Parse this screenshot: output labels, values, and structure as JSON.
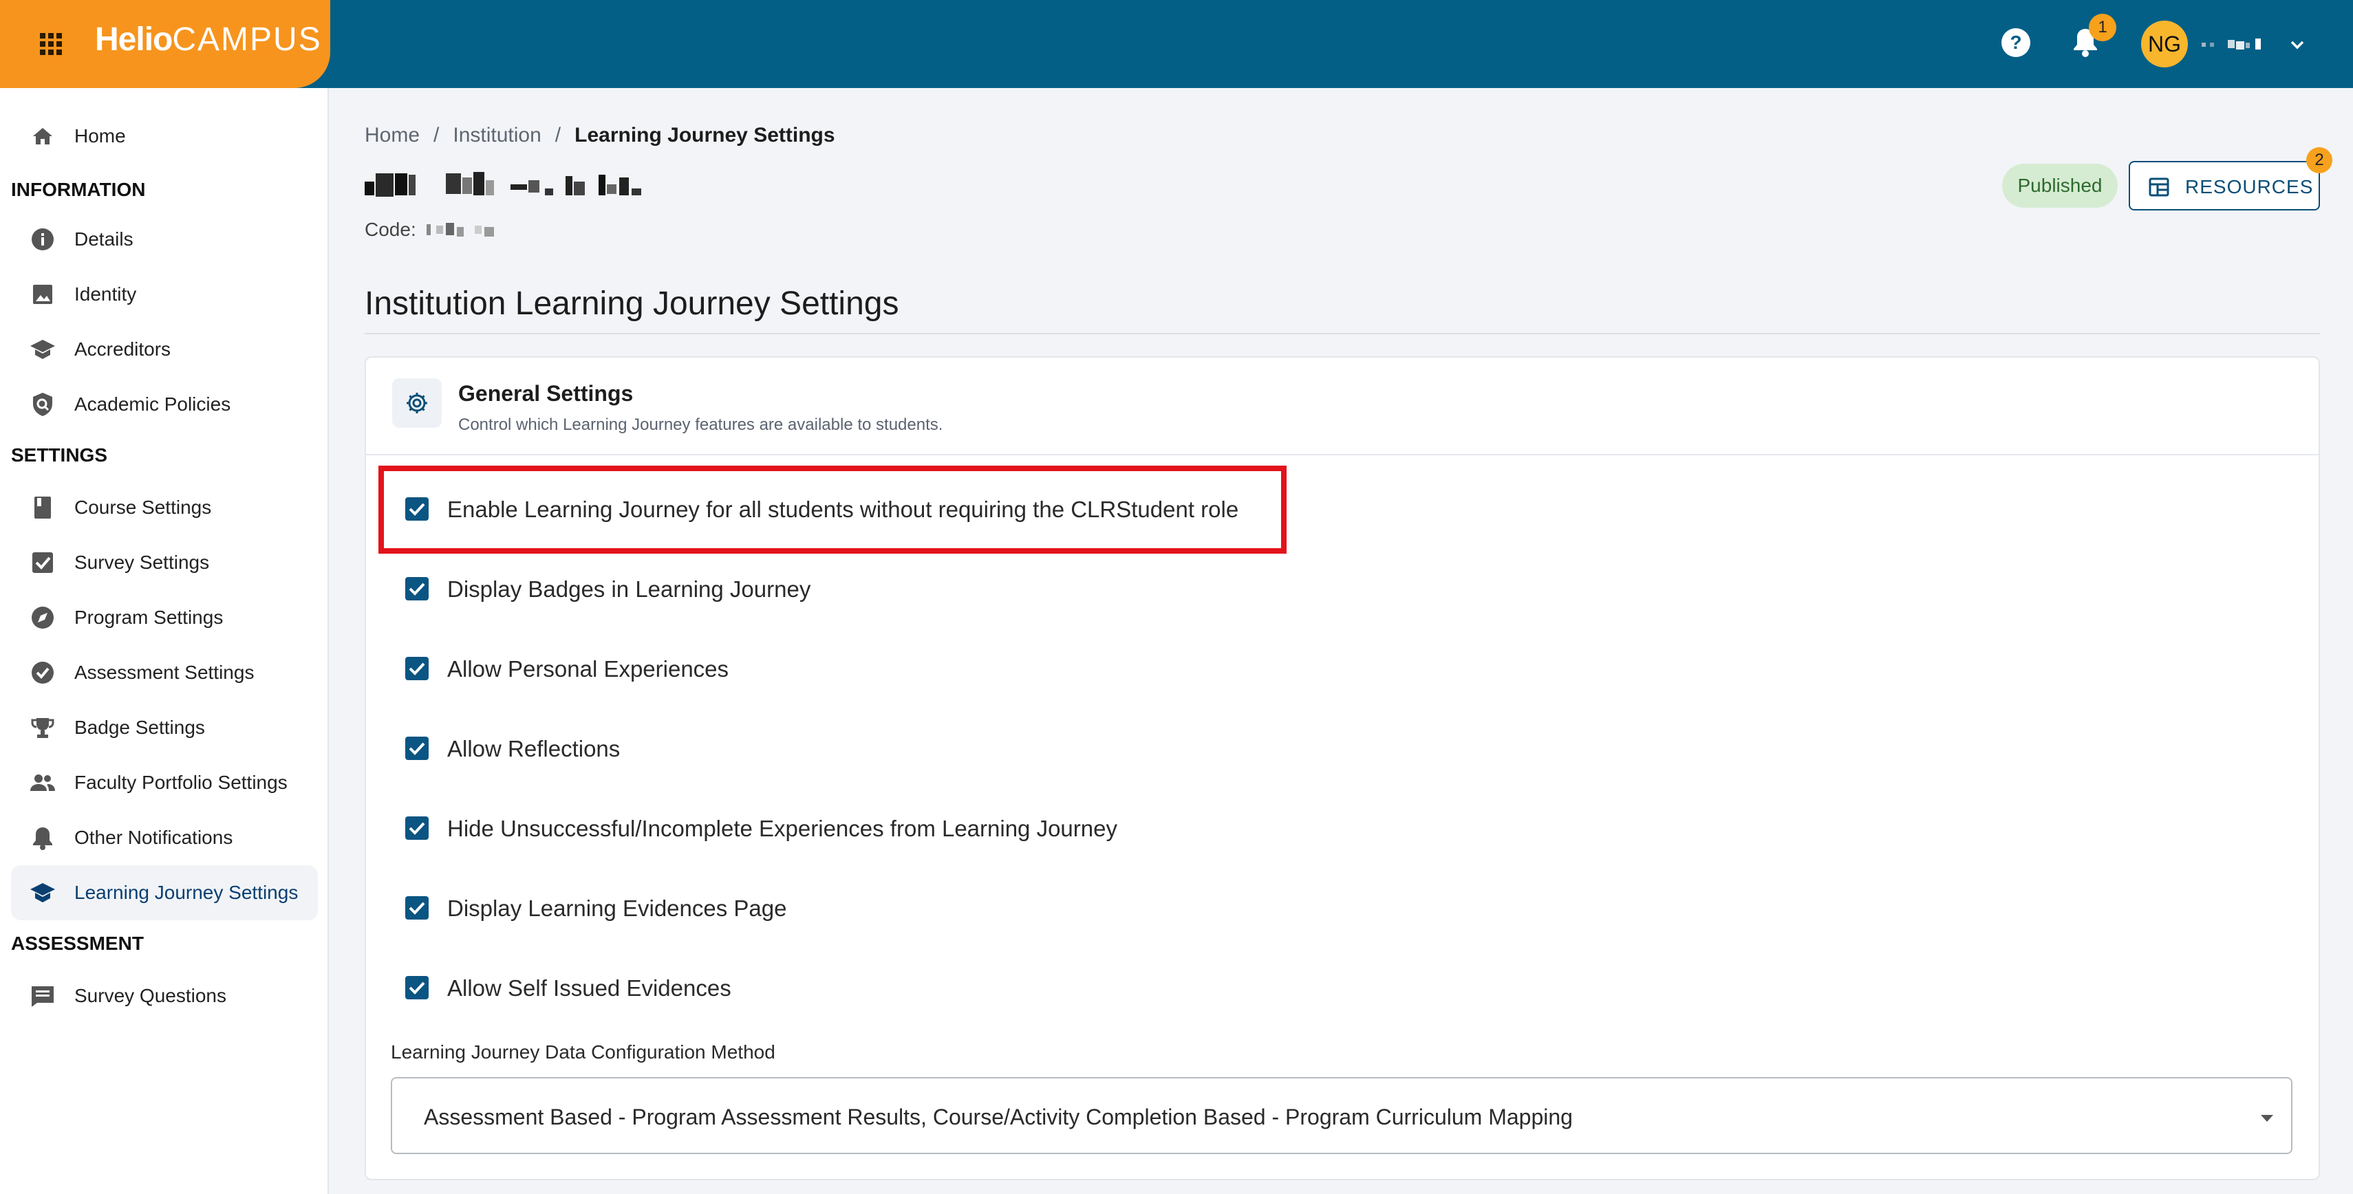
{
  "header": {
    "logo_primary": "Helio",
    "logo_secondary": "CAMPUS",
    "notification_count": "1",
    "user_initials": "NG",
    "brand_color": "#f7941d",
    "header_color": "#035f86"
  },
  "sidebar": {
    "top": [
      {
        "label": "Home",
        "icon": "home-icon"
      }
    ],
    "sections": [
      {
        "heading": "INFORMATION",
        "items": [
          {
            "label": "Details",
            "icon": "info-icon"
          },
          {
            "label": "Identity",
            "icon": "image-icon"
          },
          {
            "label": "Accreditors",
            "icon": "school-icon"
          },
          {
            "label": "Academic Policies",
            "icon": "policy-icon"
          }
        ]
      },
      {
        "heading": "SETTINGS",
        "items": [
          {
            "label": "Course Settings",
            "icon": "book-icon"
          },
          {
            "label": "Survey Settings",
            "icon": "checkbox-icon"
          },
          {
            "label": "Program Settings",
            "icon": "compass-icon"
          },
          {
            "label": "Assessment Settings",
            "icon": "check-circle-icon"
          },
          {
            "label": "Badge Settings",
            "icon": "trophy-icon"
          },
          {
            "label": "Faculty Portfolio Settings",
            "icon": "people-icon"
          },
          {
            "label": "Other Notifications",
            "icon": "bell-icon"
          },
          {
            "label": "Learning Journey Settings",
            "icon": "school-icon",
            "active": true
          }
        ]
      },
      {
        "heading": "ASSESSMENT",
        "items": [
          {
            "label": "Survey Questions",
            "icon": "comment-icon"
          }
        ]
      }
    ]
  },
  "breadcrumb": [
    "Home",
    "Institution",
    "Learning Journey Settings"
  ],
  "entity": {
    "code_label": "Code:",
    "status": "Published",
    "resources_label": "RESOURCES",
    "resources_count": "2"
  },
  "page_title": "Institution Learning Journey Settings",
  "card": {
    "title": "General Settings",
    "subtitle": "Control which Learning Journey features are available to students.",
    "options": [
      {
        "label": "Enable Learning Journey for all students without requiring the CLRStudent role",
        "checked": true
      },
      {
        "label": "Display Badges in Learning Journey",
        "checked": true
      },
      {
        "label": "Allow Personal Experiences",
        "checked": true
      },
      {
        "label": "Allow Reflections",
        "checked": true
      },
      {
        "label": "Hide Unsuccessful/Incomplete Experiences from Learning Journey",
        "checked": true
      },
      {
        "label": "Display Learning Evidences Page",
        "checked": true
      },
      {
        "label": "Allow Self Issued Evidences",
        "checked": true
      }
    ],
    "config_label": "Learning Journey Data Configuration Method",
    "config_value": "Assessment Based - Program Assessment Results, Course/Activity Completion Based - Program Curriculum Mapping"
  }
}
